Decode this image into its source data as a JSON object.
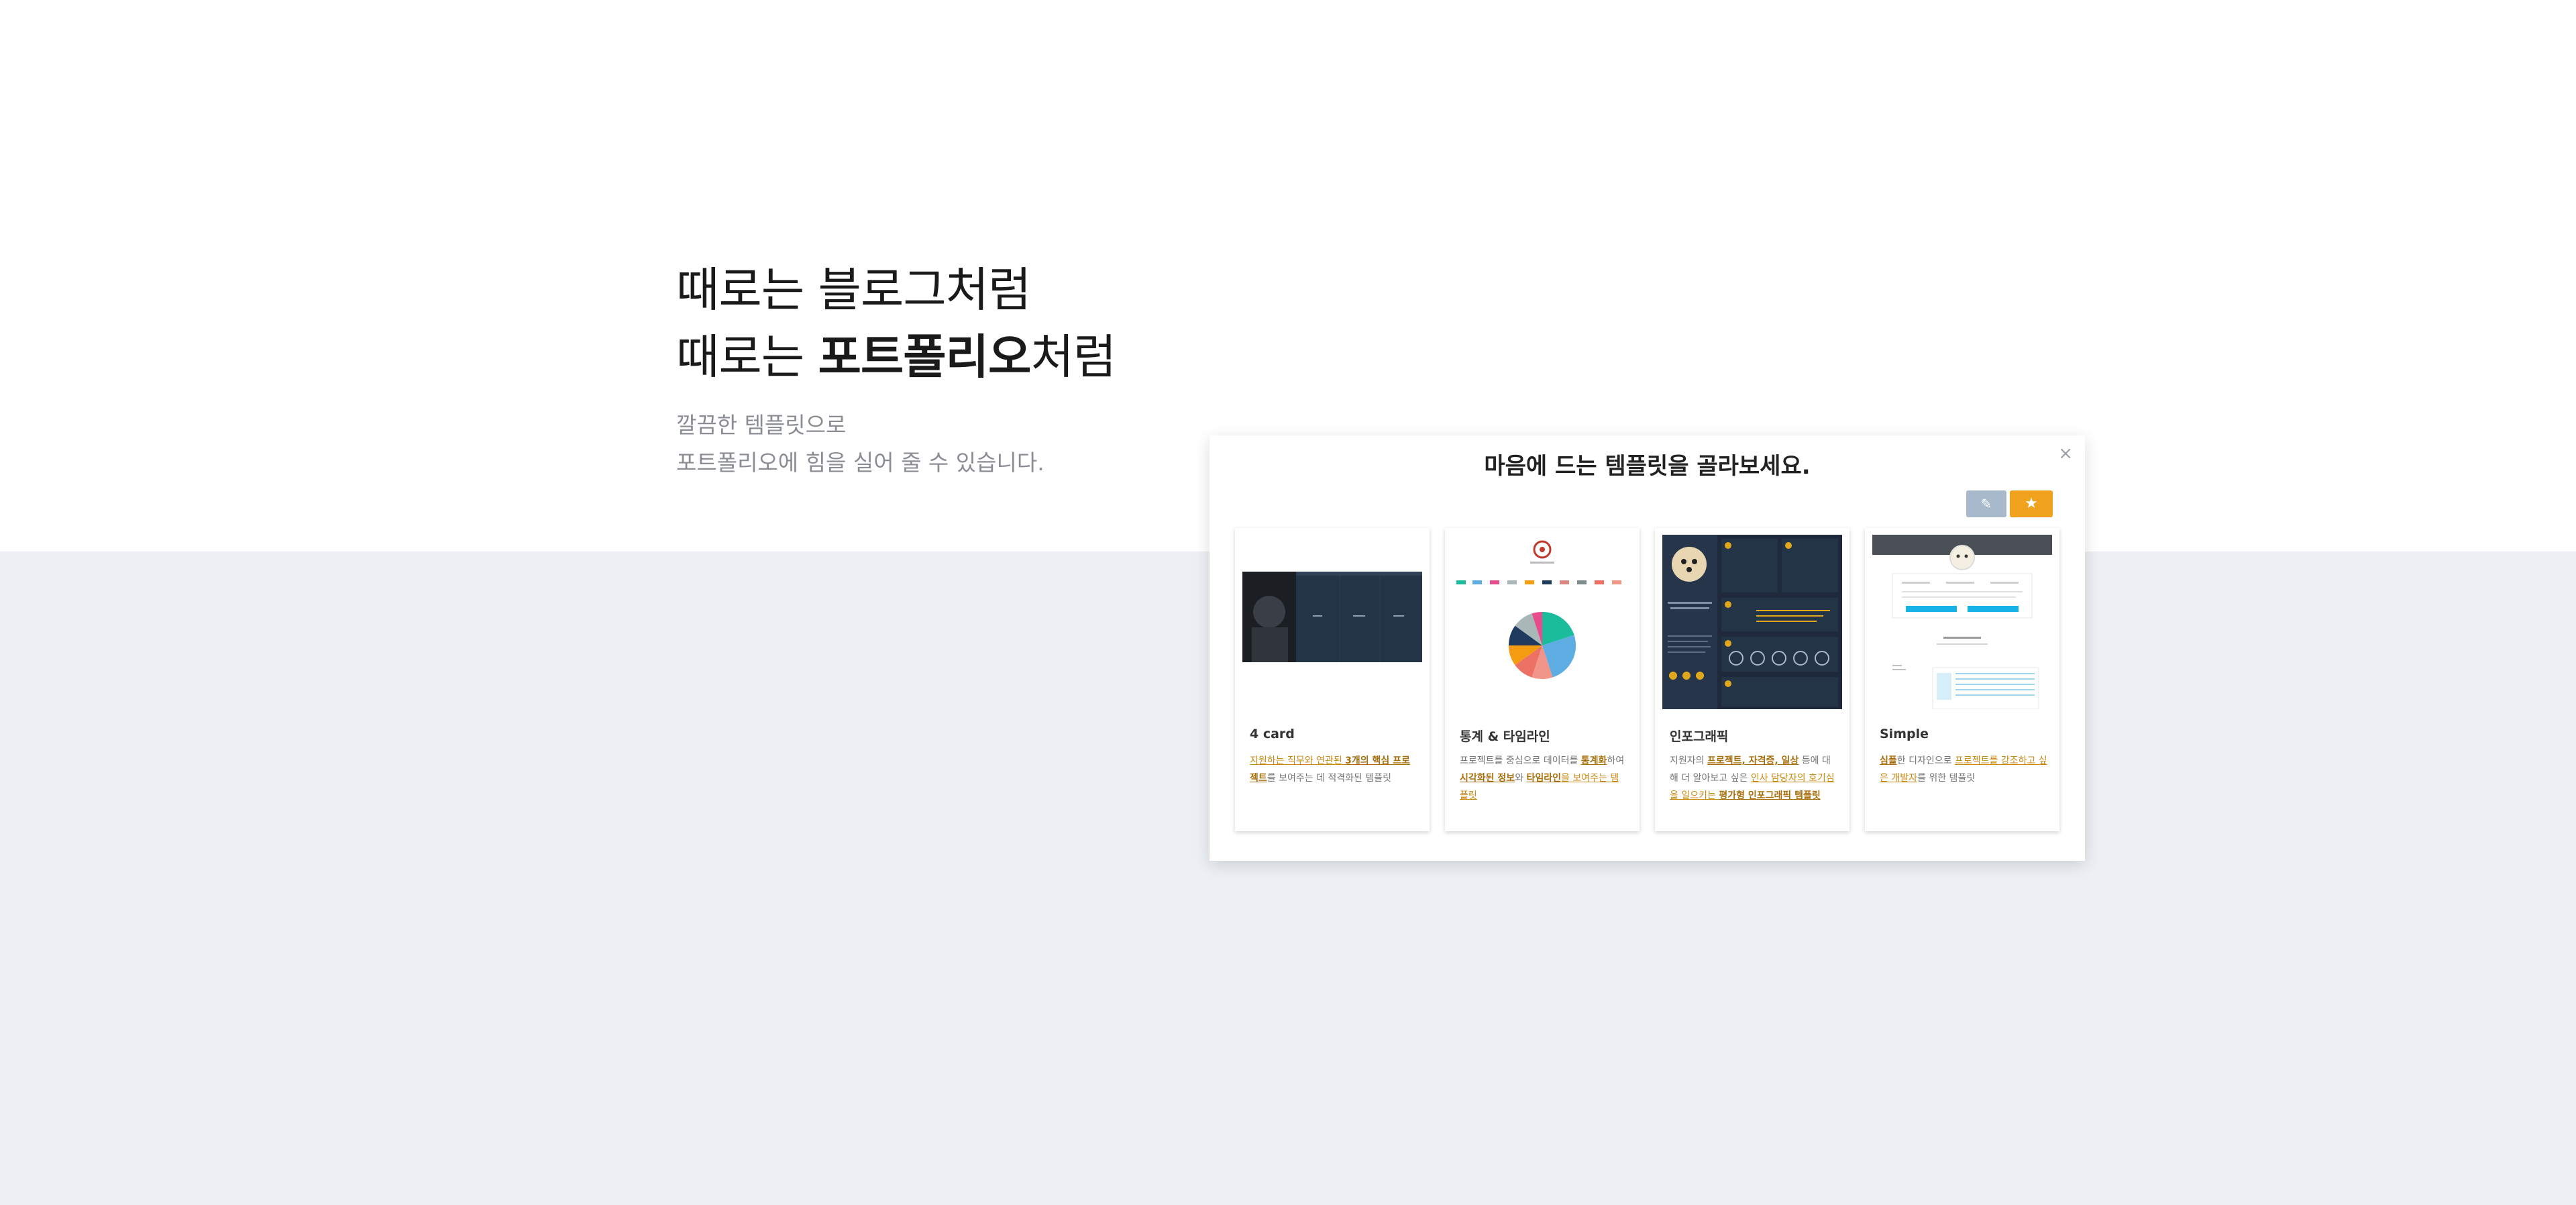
{
  "hero": {
    "line1": "때로는 블로그처럼",
    "line2_pre": "때로는 ",
    "line2_bold": "포트폴리오",
    "line2_post": "처럼",
    "sub1": "깔끔한 템플릿으로",
    "sub2": "포트폴리오에 힘을 실어 줄 수 있습니다."
  },
  "modal": {
    "title": "마음에 드는 템플릿을 골라보세요.",
    "close_icon": "×",
    "pencil_icon": "✎",
    "star_icon": "★"
  },
  "cards": [
    {
      "name": "4 card",
      "desc": [
        {
          "t": "지원하는 직무와 연관된 ",
          "s": "hl"
        },
        {
          "t": "3개의 핵심 프로젝트",
          "s": "hb"
        },
        {
          "t": "를 보여주는 데 적격화된 템플릿",
          "s": "n"
        }
      ]
    },
    {
      "name": "통계 & 타임라인",
      "desc": [
        {
          "t": "프로젝트를 중심으로 데이터를 ",
          "s": "n"
        },
        {
          "t": "통계화",
          "s": "hb"
        },
        {
          "t": "하여 ",
          "s": "n"
        },
        {
          "t": "시각화된 정보",
          "s": "hb"
        },
        {
          "t": "와 ",
          "s": "n"
        },
        {
          "t": "타임라인",
          "s": "hb"
        },
        {
          "t": "을 보여주는 템플릿",
          "s": "hl"
        }
      ]
    },
    {
      "name": "인포그래픽",
      "desc": [
        {
          "t": "지원자의 ",
          "s": "n"
        },
        {
          "t": "프로젝트, 자격증, 일상",
          "s": "hb"
        },
        {
          "t": " 등에 대해 더 알아보고 싶은 ",
          "s": "n"
        },
        {
          "t": "인사 담당자의 호기심을 일으키는 ",
          "s": "hl"
        },
        {
          "t": "평가형 인포그래픽 템플릿",
          "s": "hb"
        }
      ]
    },
    {
      "name": "Simple",
      "desc": [
        {
          "t": "심플",
          "s": "hb"
        },
        {
          "t": "한 디자인으로 ",
          "s": "n"
        },
        {
          "t": "프로젝트를 강조하고 싶은 개발자",
          "s": "hl"
        },
        {
          "t": "를 위한 템플릿",
          "s": "n"
        }
      ]
    }
  ],
  "colors": {
    "accent_orange": "#f1a21c",
    "pencil_button": "#a7b9cb",
    "page_gray": "#ecf0f4",
    "dark_navy": "#1e2a3b"
  }
}
